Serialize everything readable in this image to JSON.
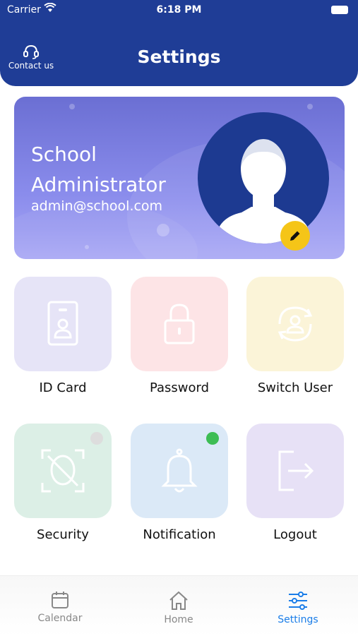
{
  "status_bar": {
    "carrier": "Carrier",
    "time": "6:18 PM"
  },
  "header": {
    "title": "Settings",
    "contact_label": "Contact us"
  },
  "profile": {
    "name": "School Administrator",
    "email": "admin@school.com"
  },
  "tiles": [
    {
      "label": "ID Card",
      "icon": "id-card-icon",
      "bg": "#e6e4f7"
    },
    {
      "label": "Password",
      "icon": "lock-icon",
      "bg": "#fde4e6"
    },
    {
      "label": "Switch User",
      "icon": "switch-user-icon",
      "bg": "#fbf4d8"
    },
    {
      "label": "Security",
      "icon": "face-scan-icon",
      "bg": "#dcefe6",
      "indicator": "#dddddd"
    },
    {
      "label": "Notification",
      "icon": "bell-icon",
      "bg": "#dbe9f7",
      "indicator": "#3dbd54"
    },
    {
      "label": "Logout",
      "icon": "logout-icon",
      "bg": "#e7e1f6"
    }
  ],
  "tabbar": {
    "items": [
      {
        "label": "Calendar",
        "icon": "calendar-icon",
        "active": false
      },
      {
        "label": "Home",
        "icon": "home-icon",
        "active": false
      },
      {
        "label": "Settings",
        "icon": "sliders-icon",
        "active": true
      }
    ]
  },
  "colors": {
    "header": "#1f3d96",
    "accent": "#1a7de8",
    "inactive_tab": "#888888",
    "edit_badge": "#f5c518"
  }
}
